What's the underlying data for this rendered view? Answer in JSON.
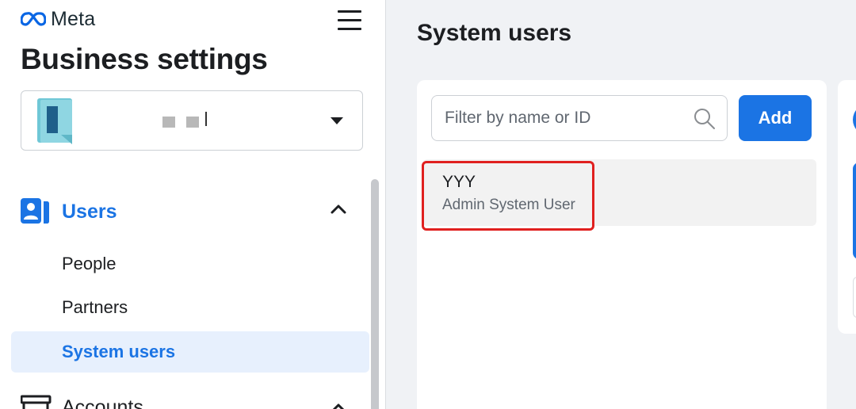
{
  "brand": {
    "logo_text": "Meta"
  },
  "sidebar": {
    "title": "Business settings",
    "account_name": "",
    "sections": [
      {
        "label": "Users",
        "expanded": true,
        "items": [
          {
            "label": "People",
            "selected": false
          },
          {
            "label": "Partners",
            "selected": false
          },
          {
            "label": "System users",
            "selected": true
          }
        ]
      },
      {
        "label": "Accounts",
        "expanded": true,
        "items": []
      }
    ]
  },
  "main": {
    "title": "System users",
    "filter": {
      "placeholder": "Filter by name or ID",
      "value": ""
    },
    "add_label": "Add",
    "list": [
      {
        "name": "YYY",
        "role": "Admin System User",
        "highlighted": true
      }
    ]
  },
  "colors": {
    "accent": "#1b74e4",
    "selected_bg": "#e7f0fd",
    "highlight": "#e0201f"
  },
  "icons": {
    "logo": "meta-infinity-icon",
    "menu": "hamburger-icon",
    "dropdown": "caret-down-icon",
    "users": "users-icon",
    "collapse": "chevron-up-icon",
    "search": "search-icon",
    "accounts": "accounts-icon"
  }
}
